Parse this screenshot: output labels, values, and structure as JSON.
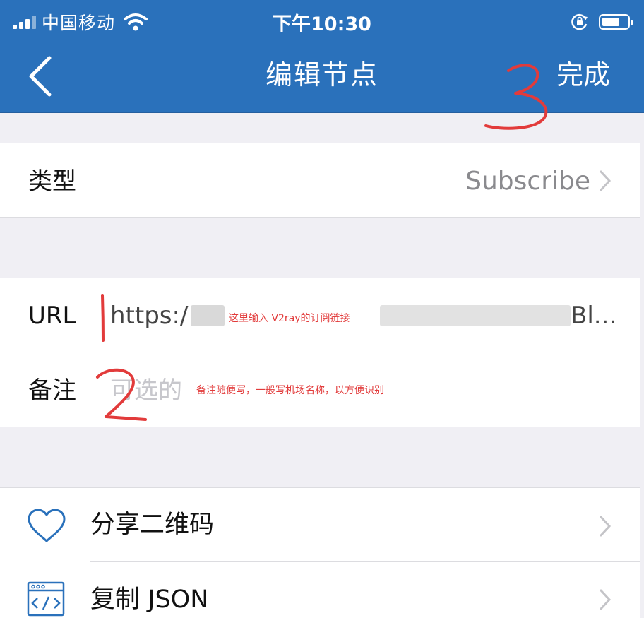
{
  "status_bar": {
    "carrier": "中国移动",
    "time": "下午10:30"
  },
  "nav": {
    "title": "编辑节点",
    "done_label": "完成"
  },
  "type_row": {
    "label": "类型",
    "value": "Subscribe"
  },
  "url_row": {
    "label": "URL",
    "value_prefix": "https:/",
    "value_tail": "Bl..."
  },
  "note_row": {
    "label": "备注",
    "placeholder": "可选的"
  },
  "annotations": {
    "url_hint": "这里输入     V2ray的订阅链接",
    "note_hint": "备注随便写，一般写机场名称，以方便识别",
    "mark_1": "1",
    "mark_2": "2",
    "mark_3": "3",
    "color": "#e23b3b"
  },
  "actions": [
    {
      "label": "分享二维码",
      "icon": "heart-icon"
    },
    {
      "label": "复制 JSON",
      "icon": "code-window-icon"
    }
  ],
  "colors": {
    "nav_bar": "#2a71bb",
    "background": "#f0eff4",
    "icon_blue": "#2a71bb",
    "secondary_text": "#8a8a8e"
  }
}
